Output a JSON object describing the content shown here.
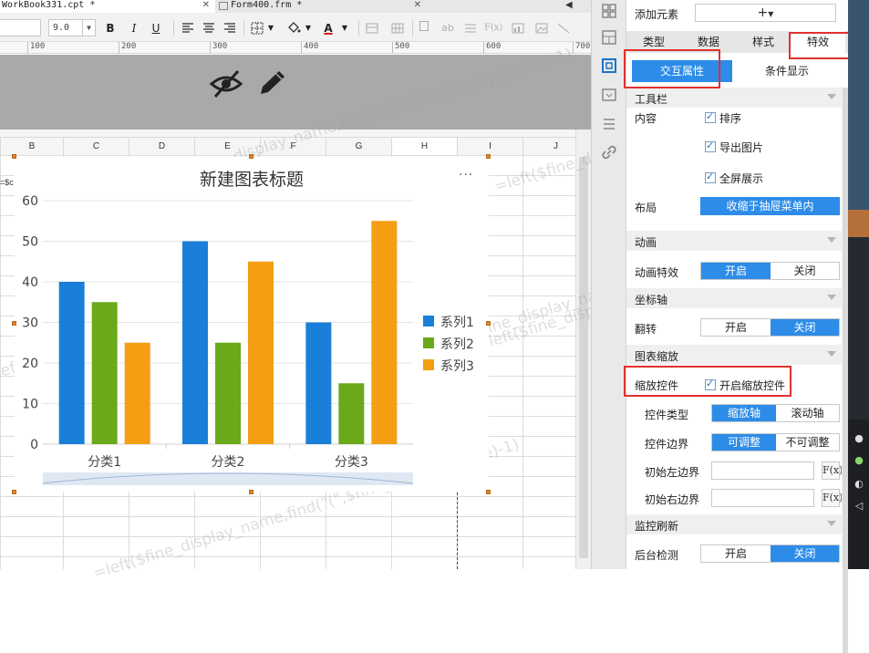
{
  "tabs": [
    {
      "label": "WorkBook331.cpt *",
      "active": true
    },
    {
      "label": "Form400.frm *",
      "active": false
    }
  ],
  "toolbar": {
    "font_size": "9.0",
    "bold": "B",
    "italic": "I",
    "underline": "U",
    "font_color_letter": "A",
    "ab_label": "ab",
    "fx_label": "F(x)"
  },
  "ruler": {
    "ticks": [
      "100",
      "200",
      "300",
      "400",
      "500",
      "600",
      "700"
    ]
  },
  "sheet": {
    "columns": [
      "B",
      "C",
      "D",
      "E",
      "F",
      "G",
      "H",
      "I",
      "J"
    ],
    "cell_fragment": "=$c"
  },
  "watermark": "=left($fine_display_name,find(\"(\",$fine_display_name)-1)",
  "chart_data": {
    "type": "bar",
    "title": "新建图表标题",
    "categories": [
      "分类1",
      "分类2",
      "分类3"
    ],
    "series": [
      {
        "name": "系列1",
        "values": [
          40,
          50,
          30
        ],
        "color": "#1a7fd9"
      },
      {
        "name": "系列2",
        "values": [
          35,
          25,
          15
        ],
        "color": "#6aaa1a"
      },
      {
        "name": "系列3",
        "values": [
          25,
          45,
          55
        ],
        "color": "#f59d13"
      }
    ],
    "ylim": [
      0,
      60
    ],
    "yticks": [
      0,
      10,
      20,
      30,
      40,
      50,
      60
    ],
    "legend": "right",
    "grid": true,
    "more_icon": "..."
  },
  "panel": {
    "add_element_label": "添加元素",
    "add_element_value": "+",
    "tabs": [
      "类型",
      "数据",
      "样式",
      "特效"
    ],
    "active_tab": "特效",
    "subtabs": [
      "交互属性",
      "条件显示"
    ],
    "active_subtab": "交互属性",
    "toolbar_section": {
      "title": "工具栏",
      "content_label": "内容",
      "options": [
        "排序",
        "导出图片",
        "全屏展示"
      ],
      "layout_label": "布局",
      "layout_value": "收缩于抽屉菜单内"
    },
    "animation_section": {
      "title": "动画",
      "effect_label": "动画特效",
      "on": "开启",
      "off": "关闭",
      "selected": "开启"
    },
    "axis_section": {
      "title": "坐标轴",
      "flip_label": "翻转",
      "on": "开启",
      "off": "关闭",
      "selected": "关闭"
    },
    "zoom_section": {
      "title": "图表缩放",
      "control_label": "缩放控件",
      "enable_label": "开启缩放控件",
      "type_label": "控件类型",
      "type_options": [
        "缩放轴",
        "滚动轴"
      ],
      "type_selected": "缩放轴",
      "border_label": "控件边界",
      "border_options": [
        "可调整",
        "不可调整"
      ],
      "border_selected": "可调整",
      "left_border_label": "初始左边界",
      "right_border_label": "初始右边界",
      "fx": "F(x)"
    },
    "refresh_section": {
      "title": "监控刷新",
      "backend_label": "后台检测",
      "on": "开启",
      "off": "关闭",
      "selected": "关闭"
    }
  },
  "colors": {
    "accent_blue": "#2c8ce8",
    "highlight_red": "#e0312e",
    "gray_band": "#a9a9a9"
  }
}
